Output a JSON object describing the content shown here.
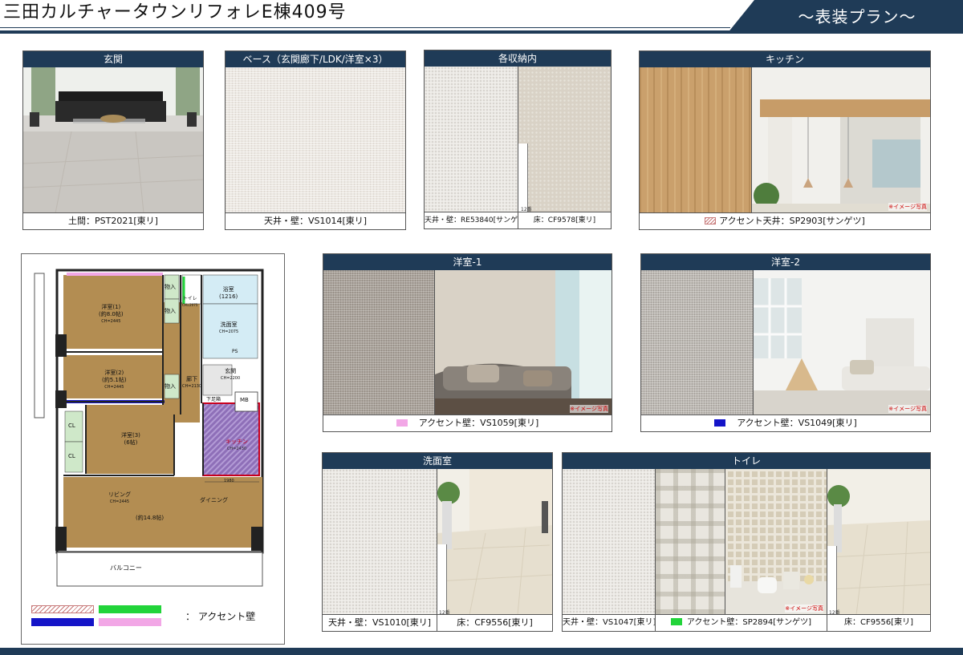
{
  "header": {
    "title": "三田カルチャータウンリフォレE棟409号",
    "banner": "～表装プラン～"
  },
  "panels": {
    "genkan": {
      "title": "玄関",
      "caption": "土間：PST2021[東リ]"
    },
    "base": {
      "title": "ベース（玄関廊下/LDK/洋室×3）",
      "caption": "天井・壁：VS1014[東リ]"
    },
    "storage": {
      "title": "各収納内",
      "caption_left": "天井・壁：RE53840[サンゲツ]",
      "caption_right": "床：CF9578[東リ]",
      "note": "12番"
    },
    "kitchen": {
      "title": "キッチン",
      "caption": "アクセント天井：SP2903[サンゲツ]",
      "image_note": "※イメージ写真"
    },
    "yoshitsu1": {
      "title": "洋室-1",
      "caption": "アクセント壁：VS1059[東リ]",
      "image_note": "※イメージ写真"
    },
    "yoshitsu2": {
      "title": "洋室-2",
      "caption": "アクセント壁：VS1049[東リ]",
      "image_note": "※イメージ写真"
    },
    "senmen": {
      "title": "洗面室",
      "caption_left": "天井・壁：VS1010[東リ]",
      "caption_right": "床：CF9556[東リ]",
      "note": "12番"
    },
    "toilet": {
      "title": "トイレ",
      "caption_left": "天井・壁：VS1047[東リ]",
      "caption_mid": "アクセント壁：SP2894[サンゲツ]",
      "caption_right": "床：CF9556[東リ]",
      "note": "12番",
      "image_note": "※イメージ写真"
    }
  },
  "plan": {
    "rooms": {
      "r1": "洋室(1)",
      "r1_size": "(約8.0帖)",
      "r1_ch": "CH=2445",
      "r2": "洋室(2)",
      "r2_size": "(約5.1帖)",
      "r2_ch": "CH=2445",
      "r3": "洋室(3)",
      "r3_size": "(6帖)",
      "living": "リビング",
      "living_ch": "CH=2445",
      "ldk_size": "(約14.8帖)",
      "dining": "ダイニング",
      "kitchen": "キッチン",
      "kitchen_ch": "CH=2430",
      "bath": "浴室",
      "bath_size": "(1216)",
      "toilet": "トイレ",
      "toilet_ch": "CH=2075",
      "wash": "洗面室",
      "wash_ch": "CH=2075",
      "genkan": "玄関",
      "genkan_ch": "CH=2200",
      "corridor": "廊下",
      "corridor_ch": "CH=2130",
      "shoebox": "下足箱",
      "closet": "物入",
      "cl": "CL",
      "ps": "PS",
      "mb": "MB",
      "balcony": "バルコニー",
      "dim": "1980"
    }
  },
  "legend": {
    "label": "：  アクセント壁"
  },
  "colors": {
    "navy": "#1f3b57",
    "accent_pink": "#f2a7e6",
    "accent_blue": "#1414c8",
    "accent_green": "#22d43a",
    "accent_hatch": "#c87a7a"
  }
}
